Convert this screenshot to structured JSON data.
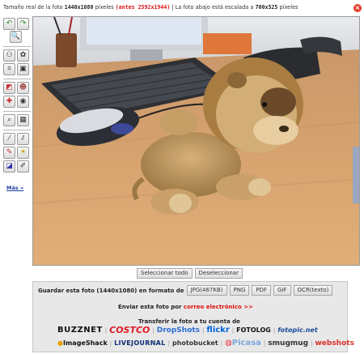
{
  "header": {
    "real_size_prefix": "Tamaño real de la foto",
    "real_size_value": "1440x1080",
    "real_size_unit": "píxeles",
    "before_value": "(antes 2592x1944)",
    "scaled_text": "| La foto abajo está escalada a",
    "scaled_value": "700x525",
    "scaled_unit": "píxeles"
  },
  "toolbar": {
    "more_label": "Más »"
  },
  "selection": {
    "select_all_label": "Seleccionar todo",
    "deselect_label": "Deseleccionar"
  },
  "save": {
    "prefix": "Guardar esta foto (1440x1080) en formato de",
    "formats": [
      "JPG(467KB)",
      "PNG",
      "PDF",
      "GIF",
      "OCR(texto)"
    ]
  },
  "email": {
    "prefix": "Enviar esta foto por",
    "link_label": "correo electrónico >>"
  },
  "transfer": {
    "title": "Transferir la foto a tu cuenta de",
    "services_row1": [
      "BUZZNET",
      "COSTCO",
      "DropShots",
      "flickr",
      "FOTOLOG",
      "fotopic.net"
    ],
    "services_row2": [
      "ImageShack",
      "LIVEJOURNAL",
      "photobucket",
      "Picasa",
      "smugmug",
      "webshots"
    ]
  },
  "colors": {
    "accent_red": "#dd1111",
    "link_blue": "#1a3fa0",
    "panel_bg": "#e8e8e8"
  }
}
